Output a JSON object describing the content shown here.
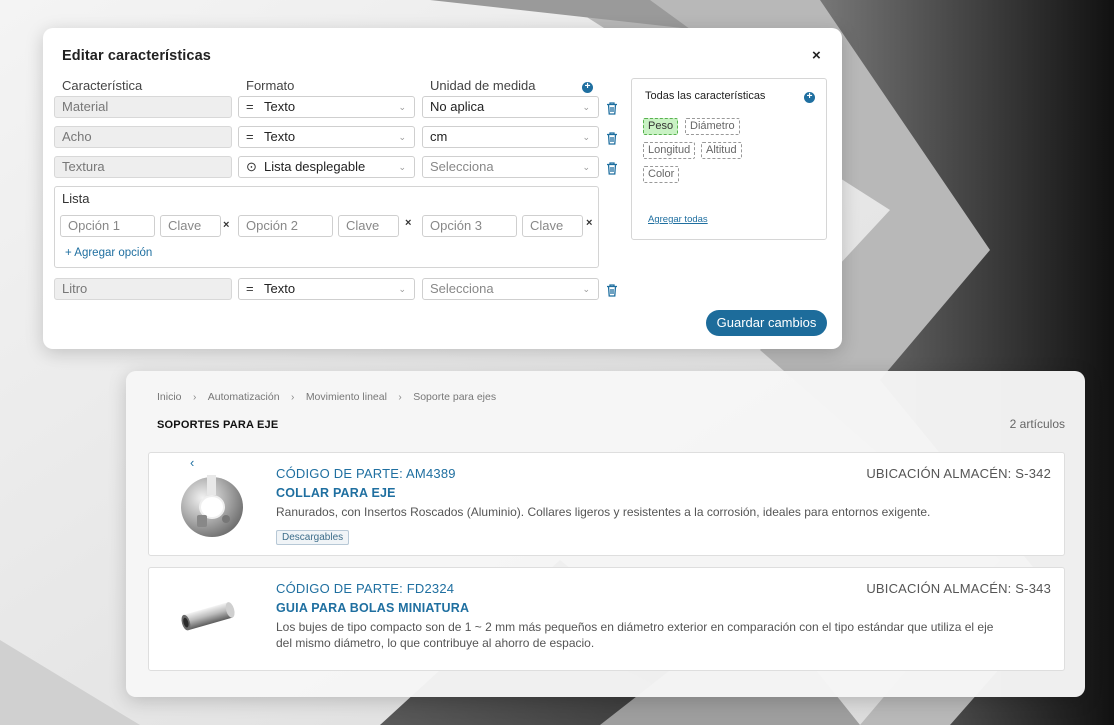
{
  "modal": {
    "title": "Editar características",
    "close": "×",
    "headers": {
      "characteristic": "Característica",
      "format": "Formato",
      "unit": "Unidad de medida"
    },
    "rows": [
      {
        "name": "Material",
        "format_icon": "=",
        "format": "Texto",
        "unit": "No aplica"
      },
      {
        "name": "Acho",
        "format_icon": "=",
        "format": "Texto",
        "unit": "cm"
      },
      {
        "name": "Textura",
        "format_icon": "⊙",
        "format": "Lista desplegable",
        "unit": "Selecciona"
      },
      {
        "name": "Litro",
        "format_icon": "=",
        "format": "Texto",
        "unit": "Selecciona"
      }
    ],
    "list": {
      "label": "Lista",
      "options": [
        {
          "option": "Opción 1",
          "key": "Clave"
        },
        {
          "option": "Opción 2",
          "key": "Clave"
        },
        {
          "option": "Opción 3",
          "key": "Clave"
        }
      ],
      "remove_glyph": "×",
      "add_option": "+  Agregar opción"
    },
    "save": "Guardar cambios",
    "all": {
      "title": "Todas las características",
      "chips": [
        "Peso",
        "Diámetro",
        "Longitud",
        "Altitud",
        "Color"
      ],
      "selected_chip": "Peso",
      "add_all": "Agregar todas"
    }
  },
  "catalog": {
    "breadcrumb": [
      "Inicio",
      "Automatización",
      "Movimiento lineal",
      "Soporte para ejes"
    ],
    "heading": "SOPORTES PARA EJE",
    "count": "2 artículos",
    "items": [
      {
        "code": "CÓDIGO DE PARTE:  AM4389",
        "location": "UBICACIÓN ALMACÉN:  S-342",
        "name": "COLLAR PARA EJE",
        "description": "Ranurados, con Insertos Roscados (Aluminio). Collares ligeros y resistentes a la corrosión, ideales para entornos exigente.",
        "tag": "Descargables",
        "nav_glyph": "‹"
      },
      {
        "code": "CÓDIGO DE PARTE:  FD2324",
        "location": "UBICACIÓN ALMACÉN:  S-343",
        "name": "GUIA PARA BOLAS MINIATURA",
        "description_line1": "Los bujes de tipo compacto son de 1 ~ 2 mm más pequeños en diámetro exterior en comparación con el tipo estándar que utiliza el eje",
        "description_line2": "del mismo diámetro, lo que contribuye al ahorro de espacio."
      }
    ]
  },
  "colors": {
    "accent": "#1f6fa0",
    "button": "#1d6c9b",
    "chip_selected": "#c9f2c4"
  },
  "icons": {
    "delete": "trash-icon",
    "add": "plus-circle-icon",
    "close": "close-icon",
    "dropdown": "chevron-down-icon",
    "crumb": "chevron-right-icon"
  }
}
